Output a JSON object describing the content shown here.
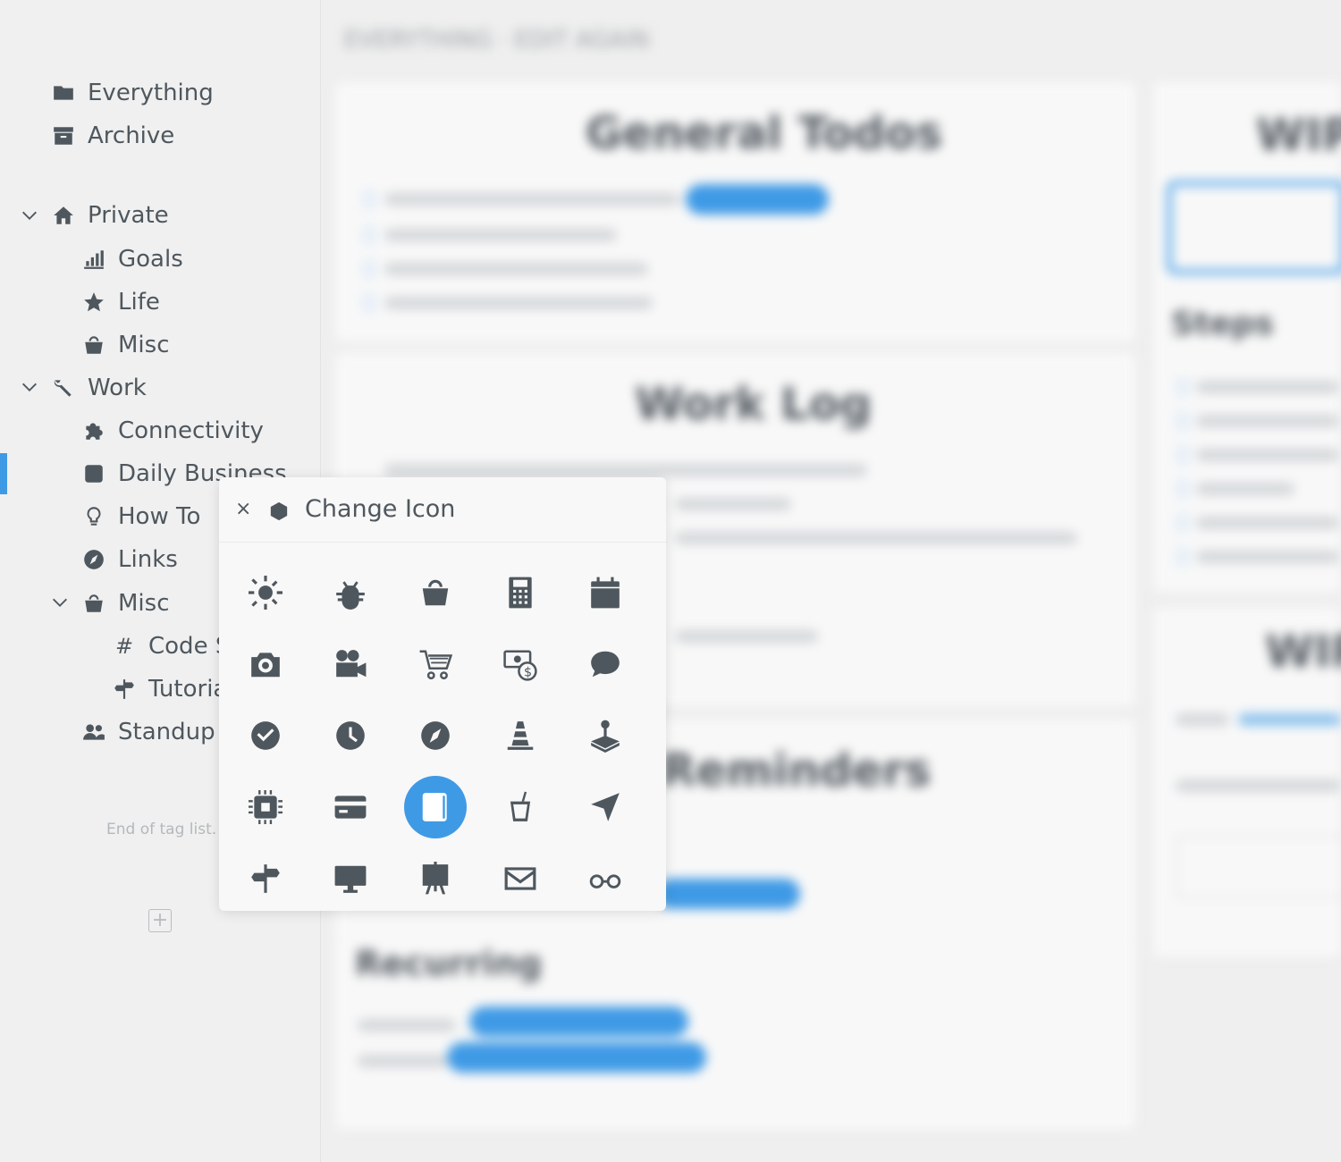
{
  "sidebar": {
    "everything": "Everything",
    "archive": "Archive",
    "private": "Private",
    "goals": "Goals",
    "life": "Life",
    "misc": "Misc",
    "work": "Work",
    "connectivity": "Connectivity",
    "daily_business": "Daily Business",
    "how_to": "How To",
    "links": "Links",
    "misc2": "Misc",
    "code_hash": "#",
    "code": "Code S",
    "tutorial": "Tutoria",
    "standup": "Standup",
    "end_text": "End of tag list.",
    "add_label": "+"
  },
  "main": {
    "breadcrumb": "EVERYTHING · EDIT AGAIN",
    "cards": [
      "General Todos",
      "Work Log",
      "Reminders",
      "Recurring",
      "WIP",
      "Steps",
      "WIP"
    ]
  },
  "popover": {
    "close_label": "×",
    "title": "Change Icon",
    "selected_index": 12,
    "icons": [
      "sun-icon",
      "bug-icon",
      "bucket-icon",
      "calculator-icon",
      "calendar-icon",
      "camera-icon",
      "video-camera-icon",
      "cart-icon",
      "money-icon",
      "comment-icon",
      "check-circle-icon",
      "clock-icon",
      "compass-icon",
      "traffic-cone-icon",
      "joystick-icon",
      "chip-icon",
      "credit-card-icon",
      "square-icon",
      "cup-icon",
      "location-arrow-icon",
      "signpost-icon",
      "desktop-icon",
      "easel-icon",
      "envelope-icon",
      "glasses-icon"
    ]
  },
  "colors": {
    "accent": "#3f9ae6",
    "icon": "#4f575e",
    "sidebar_bg": "#f0f0f0"
  }
}
